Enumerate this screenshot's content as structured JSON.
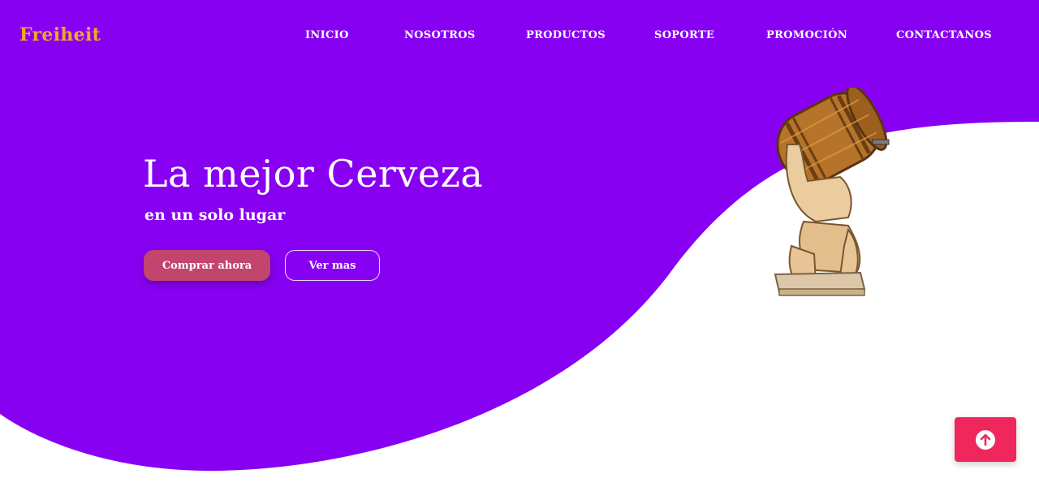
{
  "brand": {
    "name": "Freiheit",
    "color": "#f5a623"
  },
  "nav": {
    "items": [
      {
        "label": "Inicio"
      },
      {
        "label": "Nosotros"
      },
      {
        "label": "Productos"
      },
      {
        "label": "Soporte"
      },
      {
        "label": "Promoción"
      },
      {
        "label": "Contactanos"
      }
    ]
  },
  "hero": {
    "title": "La mejor Cerveza",
    "subtitle": "en un solo lugar",
    "primary_button": "Comprar ahora",
    "secondary_button": "Ver mas",
    "image": "atlas-carrying-barrel-illustration"
  },
  "scroll_top": {
    "icon": "arrow-up-circle-icon"
  },
  "colors": {
    "background_purple": "#8800f2",
    "primary_button": "#c2456e",
    "scroll_top_button": "#f0275c",
    "text": "#ffffff"
  }
}
